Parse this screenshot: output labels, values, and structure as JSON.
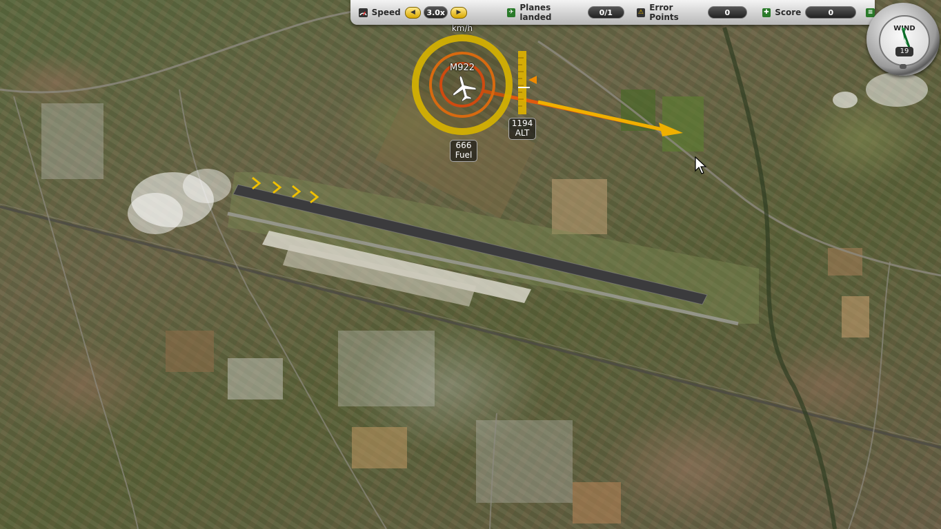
{
  "toolbar": {
    "speed_label": "Speed",
    "speed_value": "3.0x",
    "planes_landed_label": "Planes landed",
    "planes_landed_value": "0/1",
    "error_points_label": "Error Points",
    "error_points_value": "0",
    "score_label": "Score",
    "score_value": "0"
  },
  "compass": {
    "label": "WIND",
    "value": "19"
  },
  "aircraft": {
    "callsign": "M922",
    "speed_unit": "km/h",
    "altitude_value": "1194",
    "altitude_label": "ALT",
    "fuel_value": "666",
    "fuel_label": "Fuel"
  },
  "icons": {
    "speed": "speed-gauge-icon",
    "planes": "plane-icon",
    "errors": "warning-icon",
    "score": "score-icon",
    "menu": "menu-icon",
    "cursor": "mouse-cursor-icon"
  },
  "colors": {
    "ring_outer": "#d8b400",
    "ring_inner": "#d06010",
    "heading_arrow": "#f0b000",
    "toolbar_bg": "#d8d8d8"
  }
}
